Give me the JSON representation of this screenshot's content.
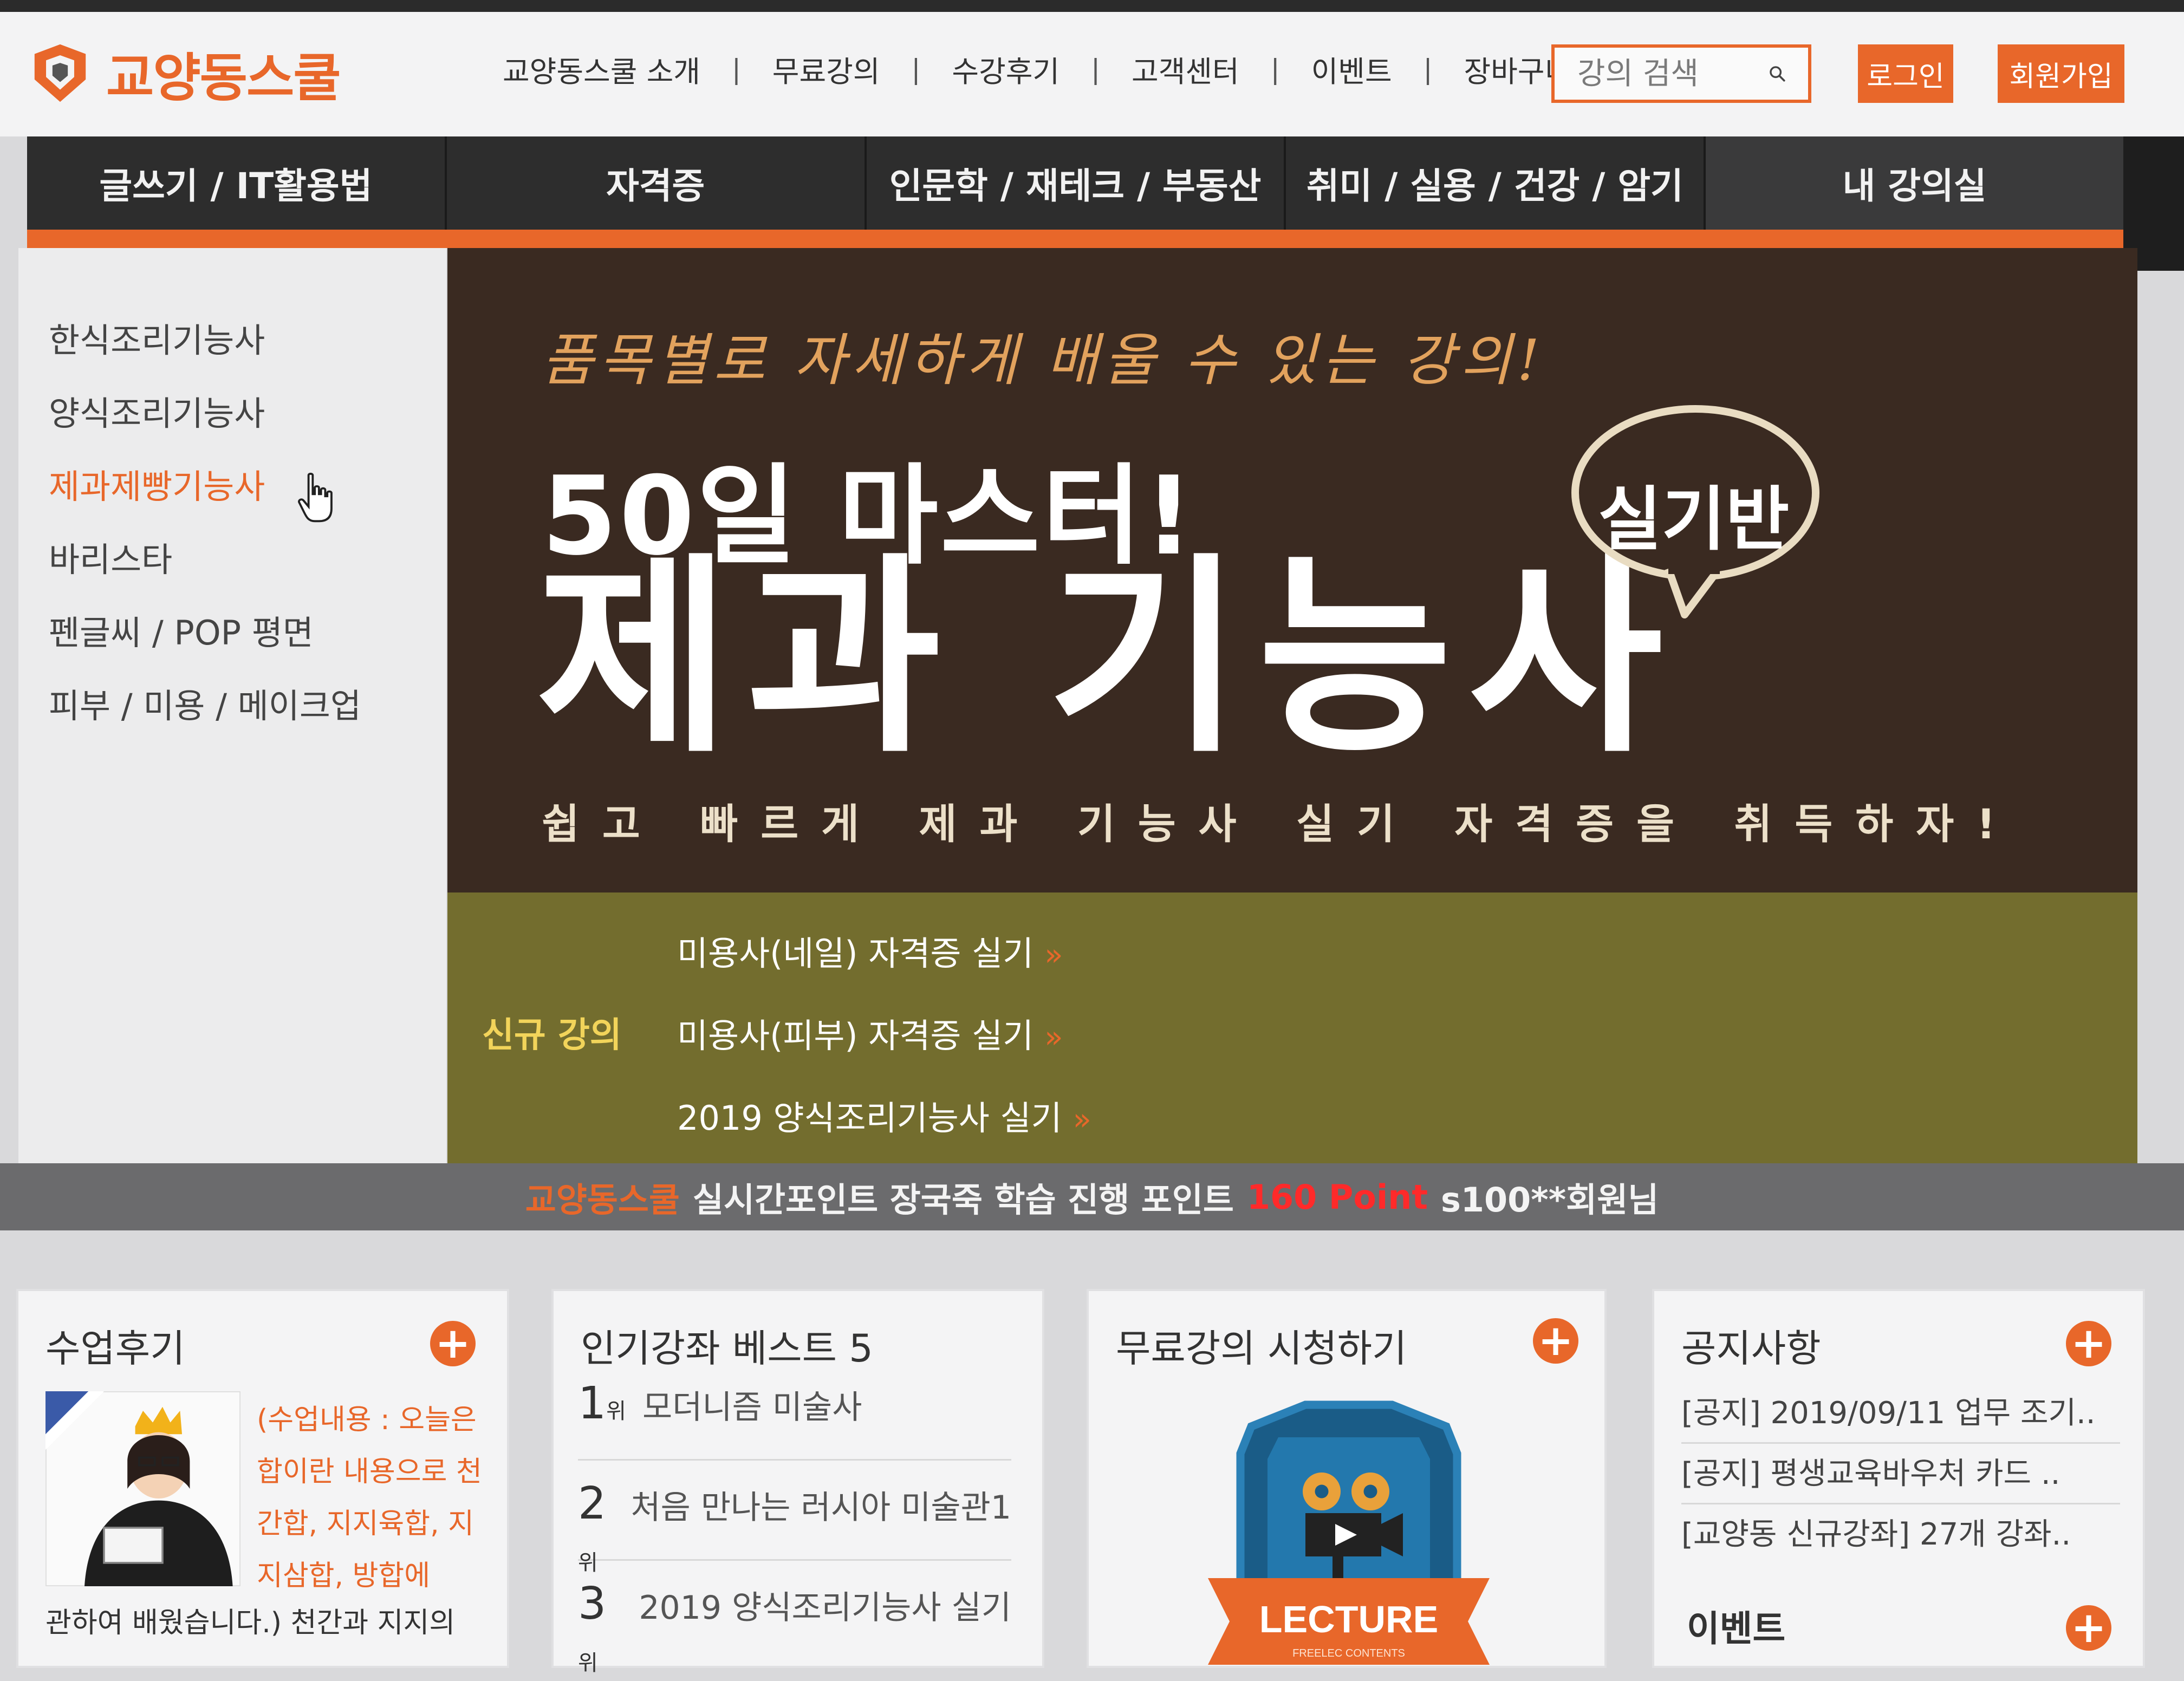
{
  "header": {
    "logo_text": "교양동스쿨",
    "nav": [
      "교양동스쿨 소개",
      "무료강의",
      "수강후기",
      "고객센터",
      "이벤트",
      "장바구니"
    ],
    "search_placeholder": "강의 검색",
    "login_label": "로그인",
    "join_label": "회원가입"
  },
  "main_nav": [
    "글쓰기 / IT활용법",
    "자격증",
    "인문학 / 재테크 / 부동산",
    "취미 / 실용 / 건강 / 암기",
    "내 강의실"
  ],
  "sidebar": {
    "items": [
      "한식조리기능사",
      "양식조리기능사",
      "제과제빵기능사",
      "바리스타",
      "펜글씨 / POP 평면",
      "피부 / 미용 / 메이크업"
    ],
    "active_index": 2
  },
  "banner": {
    "script_line": "품목별로 자세하게 배울 수 있는 강의!",
    "subtitle": "50일 마스터!",
    "title": "제과 기능사",
    "bubble": "실기반",
    "tagline": "쉽고 빠르게 제과 기능사 실기 자격증을 취득하자!"
  },
  "new_lectures": {
    "label": "신규 강의",
    "arrow": "»",
    "items": [
      "미용사(네일) 자격증 실기",
      "미용사(피부) 자격증 실기",
      "2019 양식조리기능사 실기"
    ]
  },
  "points_bar": {
    "brand": "교양동스쿨",
    "text": "실시간포인트 장국죽 학습 진행 포인트",
    "points": "160 Point",
    "member": "s100**회원님"
  },
  "panels": {
    "review": {
      "title": "수업후기",
      "text": "(수업내용 : 오늘은 합이란 내용으로 천간합, 지지육합, 지지삼합, 방합에",
      "text_tail": "관하여 배웠습니다.) 천간과 지지의"
    },
    "best": {
      "title": "인기강좌 베스트 5",
      "rank_suffix": "위",
      "items": [
        {
          "rank": "1",
          "title": "모더니즘 미술사"
        },
        {
          "rank": "2",
          "title": "처음 만나는 러시아 미술관1"
        },
        {
          "rank": "3",
          "title": "2019 양식조리기능사 실기"
        }
      ]
    },
    "free": {
      "title": "무료강의 시청하기",
      "badge_text": "LECTURE",
      "badge_sub": "FREELEC CONTENTS"
    },
    "notice": {
      "title": "공지사항",
      "items": [
        "[공지] 2019/09/11 업무 조기..",
        "[공지] 평생교육바우처 카드 ..",
        "[교양동 신규강좌] 27개 강좌.."
      ],
      "events_title": "이벤트"
    }
  },
  "colors": {
    "accent": "#e8672a",
    "banner_bg": "#3a2a21",
    "new_box_bg": "#736d2e",
    "nav_bg": "#2d2d2d"
  }
}
